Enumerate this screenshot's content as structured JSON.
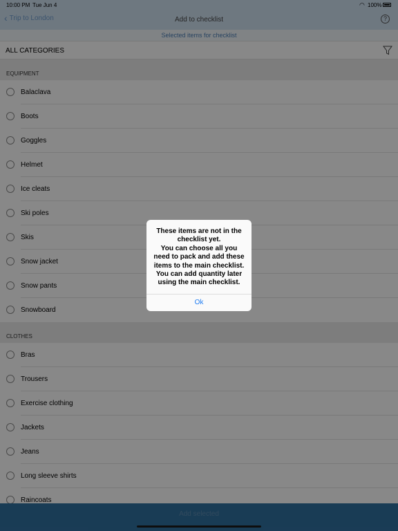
{
  "status": {
    "time": "10:00 PM",
    "date": "Tue Jun 4",
    "battery": "100%"
  },
  "nav": {
    "back_label": "Trip to London",
    "title": "Add to checklist"
  },
  "subtitle": "Selected items for checklist",
  "filter": {
    "label": "ALL CATEGORIES"
  },
  "sections": [
    {
      "title": "EQUIPMENT",
      "items": [
        "Balaclava",
        "Boots",
        "Goggles",
        "Helmet",
        "Ice cleats",
        "Ski poles",
        "Skis",
        "Snow jacket",
        "Snow pants",
        "Snowboard"
      ]
    },
    {
      "title": "CLOTHES",
      "items": [
        "Bras",
        "Trousers",
        "Exercise clothing",
        "Jackets",
        "Jeans",
        "Long sleeve shirts",
        "Raincoats"
      ]
    }
  ],
  "footer": {
    "button_label": "Add selected"
  },
  "alert": {
    "message": "These items are not in the checklist yet.\nYou can choose all you need to pack and add these items to the main checklist.\nYou can add quantity later using the main checklist.",
    "ok_label": "Ok"
  },
  "colors": {
    "nav_bg": "#c9daea",
    "accent": "#1e7cf2",
    "footer_bg": "#2f6d9c"
  }
}
